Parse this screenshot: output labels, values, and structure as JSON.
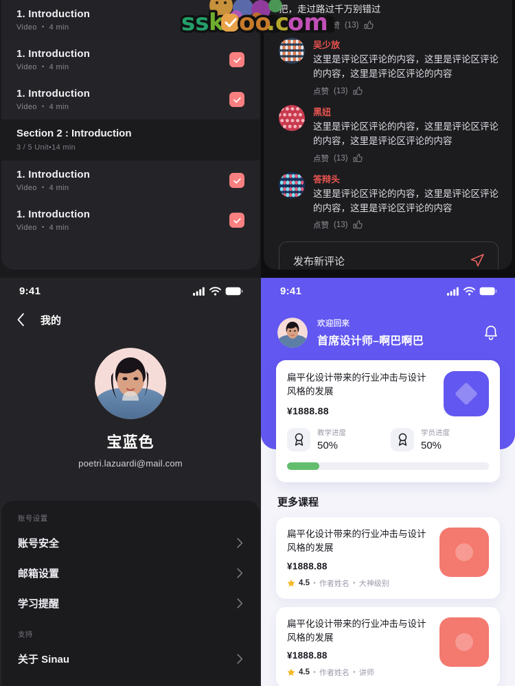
{
  "panel_course_list": {
    "lessons_top": [
      {
        "title": "1. Introduction",
        "type": "Video",
        "sep": "•",
        "duration": "4 min",
        "checked": false
      },
      {
        "title": "1. Introduction",
        "type": "Video",
        "sep": "•",
        "duration": "4 min",
        "checked": true
      },
      {
        "title": "1. Introduction",
        "type": "Video",
        "sep": "•",
        "duration": "4 min",
        "checked": true
      }
    ],
    "section": {
      "title": "Section 2 : Introduction",
      "units": "3 / 5 Unit",
      "sep": "•",
      "duration": "14 min"
    },
    "lessons_bottom": [
      {
        "title": "1. Introduction",
        "type": "Video",
        "sep": "•",
        "duration": "4 min",
        "checked": true
      },
      {
        "title": "1. Introduction",
        "type": "Video",
        "sep": "•",
        "duration": "4 min",
        "checked": true
      }
    ],
    "check_color": "#f98080"
  },
  "panel_comments": {
    "partial_comment": {
      "text": "把，走过路过千万别错过",
      "like_label": "点赞",
      "like_count": "(13)"
    },
    "comments": [
      {
        "name": "吴少放",
        "name_color": "#e8544f",
        "text": "这里是评论区评论的内容，这里是评论区评论的内容，这里是评论区评论的内容",
        "like_label": "点赞",
        "like_count": "(13)"
      },
      {
        "name": "黑妞",
        "name_color": "#e8544f",
        "text": "这里是评论区评论的内容，这里是评论区评论的内容，这里是评论区评论的内容",
        "like_label": "点赞",
        "like_count": "(13)"
      },
      {
        "name": "答辩头",
        "name_color": "#e8544f",
        "text": "这里是评论区评论的内容，这里是评论区评论的内容，这里是评论区评论的内容",
        "like_label": "点赞",
        "like_count": "(13)"
      }
    ],
    "composer": {
      "placeholder": "发布新评论",
      "send_icon": "send-icon"
    }
  },
  "panel_profile": {
    "status_bar": {
      "time": "9:41"
    },
    "nav": {
      "back_icon": "chevron-left-icon",
      "title": "我的"
    },
    "user": {
      "name": "宝蓝色",
      "email": "poetri.lazuardi@mail.com"
    },
    "groups": [
      {
        "label": "账号设置",
        "items": [
          {
            "label": "账号安全"
          },
          {
            "label": "邮箱设置"
          },
          {
            "label": "学习提醒"
          }
        ]
      },
      {
        "label": "支持",
        "items": [
          {
            "label": "关于 Sinau"
          }
        ]
      }
    ]
  },
  "panel_home": {
    "status_bar": {
      "time": "9:41"
    },
    "accent_color": "#6257f0",
    "greeting": {
      "hello": "欢迎回来",
      "name": "首席设计师–啊巴啊巴",
      "bell_icon": "bell-icon"
    },
    "hero_card": {
      "title": "扁平化设计带来的行业冲击与设计风格的发展",
      "price": "¥1888.88",
      "stats": [
        {
          "label": "教学进度",
          "value": "50%",
          "icon": "medal-icon"
        },
        {
          "label": "学员进度",
          "value": "50%",
          "icon": "medal-icon"
        }
      ],
      "progress_percent": 16,
      "progress_color": "#62bd6d"
    },
    "more_title": "更多课程",
    "courses": [
      {
        "title": "扁平化设计带来的行业冲击与设计风格的发展",
        "price": "¥1888.88",
        "rating": "4.5",
        "author": "作者姓名",
        "level": "大神级别",
        "sep": "•",
        "thumb_color": "#f4796f"
      },
      {
        "title": "扁平化设计带来的行业冲击与设计风格的发展",
        "price": "¥1888.88",
        "rating": "4.5",
        "author": "作者姓名",
        "level": "讲师",
        "sep": "•",
        "thumb_color": "#f4796f"
      }
    ]
  },
  "watermark": {
    "text": "sskoo.com"
  }
}
